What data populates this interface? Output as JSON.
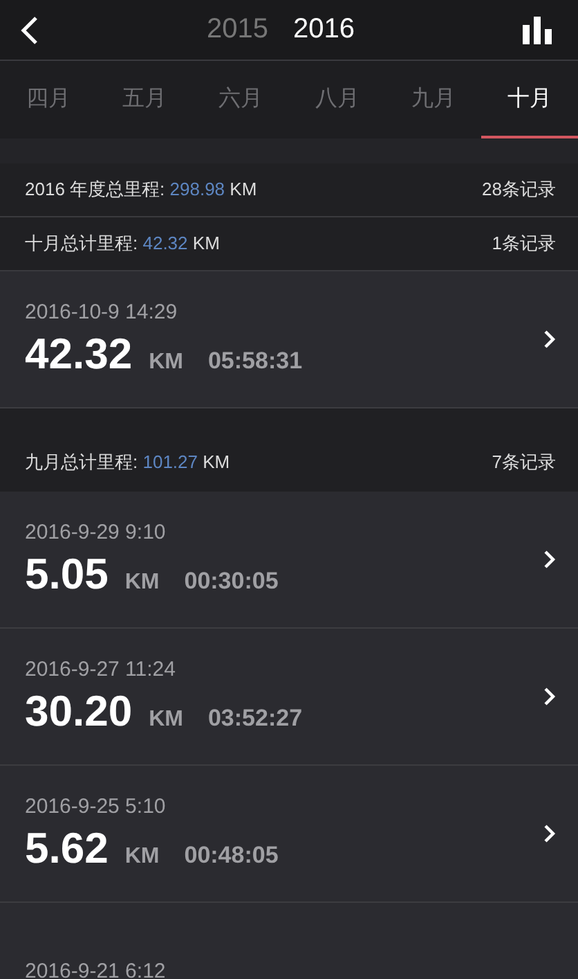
{
  "years": [
    {
      "label": "2015",
      "selected": false
    },
    {
      "label": "2016",
      "selected": true
    }
  ],
  "tabs": [
    {
      "label": "四月",
      "selected": false
    },
    {
      "label": "五月",
      "selected": false
    },
    {
      "label": "六月",
      "selected": false
    },
    {
      "label": "八月",
      "selected": false
    },
    {
      "label": "九月",
      "selected": false
    },
    {
      "label": "十月",
      "selected": true
    }
  ],
  "year_summary": {
    "label": "2016 年度总里程: ",
    "value": "298.98",
    "unit": " KM",
    "count": "28条记录"
  },
  "months": [
    {
      "summary": {
        "label": "十月总计里程: ",
        "value": "42.32",
        "unit": " KM",
        "count": "1条记录"
      },
      "records": [
        {
          "datetime": "2016-10-9 14:29",
          "distance": "42.32",
          "unit": "KM",
          "duration": "05:58:31"
        }
      ]
    },
    {
      "summary": {
        "label": "九月总计里程: ",
        "value": "101.27",
        "unit": " KM",
        "count": "7条记录"
      },
      "records": [
        {
          "datetime": "2016-9-29 9:10",
          "distance": "5.05",
          "unit": "KM",
          "duration": "00:30:05"
        },
        {
          "datetime": "2016-9-27 11:24",
          "distance": "30.20",
          "unit": "KM",
          "duration": "03:52:27"
        },
        {
          "datetime": "2016-9-25 5:10",
          "distance": "5.62",
          "unit": "KM",
          "duration": "00:48:05"
        },
        {
          "datetime": "2016-9-21 6:12"
        }
      ]
    }
  ]
}
